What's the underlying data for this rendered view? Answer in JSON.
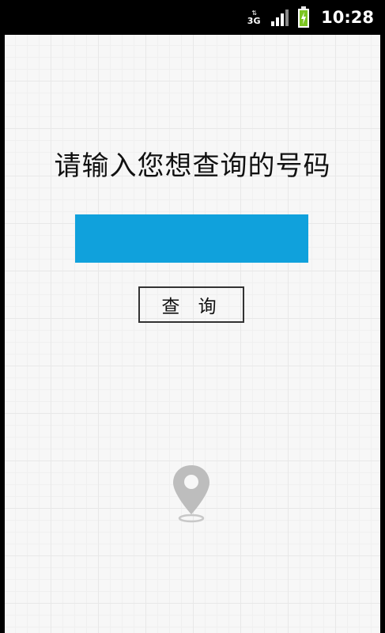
{
  "status_bar": {
    "network_type": "3G",
    "network_arrows": "⇅",
    "time": "10:28"
  },
  "main": {
    "prompt": "请输入您想查询的号码",
    "number_input_value": "",
    "number_input_placeholder": "",
    "query_button_label": "查 询"
  },
  "icons": {
    "network": "data-3g-icon",
    "signal": "signal-strength-icon",
    "battery": "battery-charging-icon",
    "location": "location-pin-icon"
  },
  "colors": {
    "input_background": "#10a1dc",
    "battery_fill": "#7cc521",
    "pin": "#bdbdbd"
  }
}
